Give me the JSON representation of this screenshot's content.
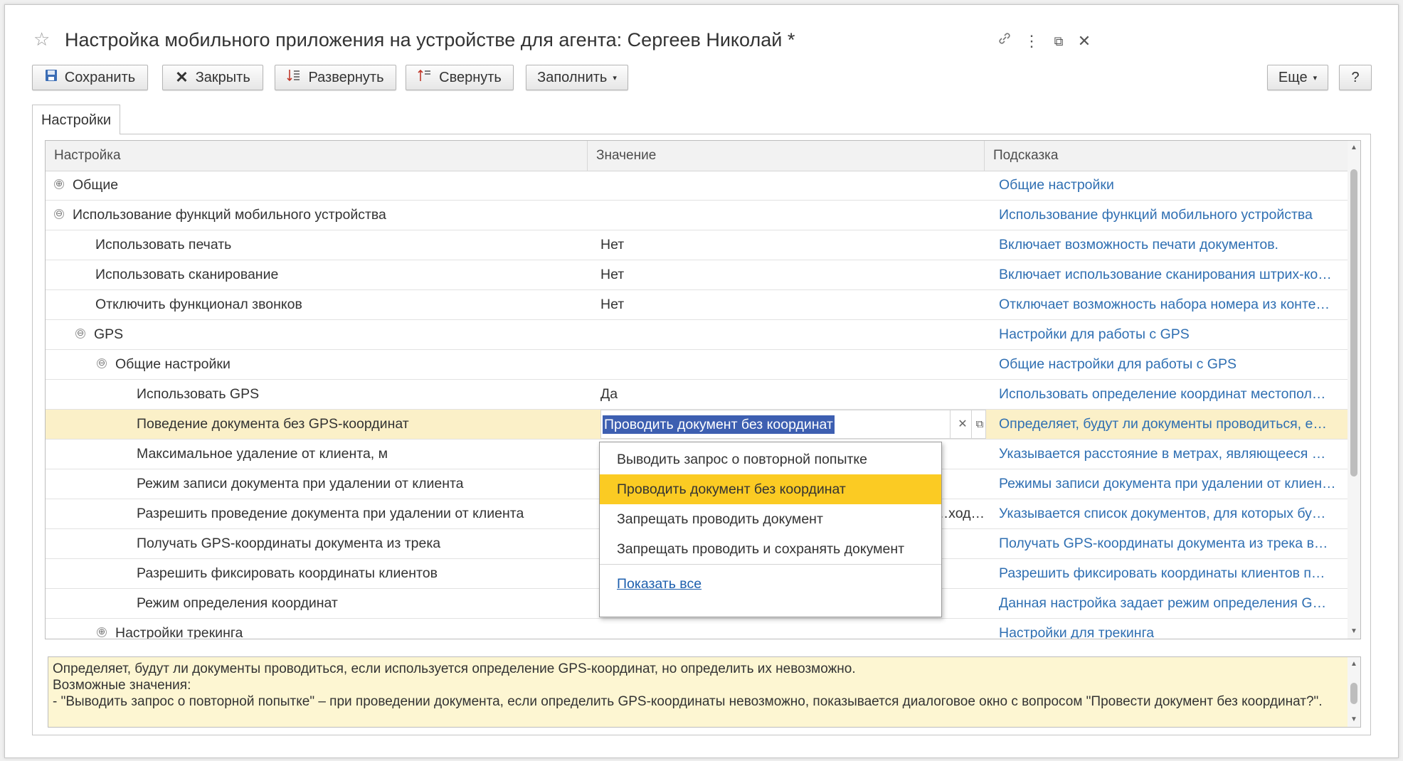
{
  "window": {
    "title": "Настройка мобильного приложения на устройстве для агента: Сергеев Николай *",
    "star_icon": "☆",
    "controls": {
      "link": "🔗",
      "more": "⋮",
      "restore": "⧉",
      "close": "✕"
    }
  },
  "toolbar": {
    "save_label": "Сохранить",
    "close_label": "Закрыть",
    "expand_label": "Развернуть",
    "collapse_label": "Свернуть",
    "fill_label": "Заполнить",
    "more_label": "Еще",
    "help_label": "?"
  },
  "tabs": [
    {
      "label": "Настройки"
    }
  ],
  "grid": {
    "headers": {
      "setting": "Настройка",
      "value": "Значение",
      "hint": "Подсказка"
    },
    "rows": [
      {
        "name": "Общие",
        "value": "",
        "hint": "Общие настройки",
        "tree": "⊕"
      },
      {
        "name": "Использование функций мобильного устройства",
        "value": "",
        "hint": "Использование функций мобильного устройства",
        "tree": "⊖"
      },
      {
        "name": "Использовать печать",
        "value": "Нет",
        "hint": "Включает возможность печати документов.",
        "tree": ""
      },
      {
        "name": "Использовать сканирование",
        "value": "Нет",
        "hint": "Включает использование сканирования штрих-ко…",
        "tree": ""
      },
      {
        "name": "Отключить функционал звонков",
        "value": "Нет",
        "hint": "Отключает возможность набора номера из конте…",
        "tree": ""
      },
      {
        "name": "GPS",
        "value": "",
        "hint": "Настройки для работы с GPS",
        "tree": "⊖"
      },
      {
        "name": "Общие настройки",
        "value": "",
        "hint": "Общие настройки для работы с GPS",
        "tree": "⊖"
      },
      {
        "name": "Использовать GPS",
        "value": "Да",
        "hint": "Использовать определение координат местопол…",
        "tree": ""
      },
      {
        "name": "Поведение документа без GPS-координат",
        "value": "Проводить документ без координат",
        "hint": "Определяет, будут ли документы проводиться, е…",
        "tree": ""
      },
      {
        "name": "Максимальное удаление от клиента, м",
        "value": "",
        "hint": "Указывается расстояние в метрах, являющееся …",
        "tree": ""
      },
      {
        "name": "Режим записи документа при удалении от клиента",
        "value": "",
        "hint": "Режимы записи документа при удалении от клиен…",
        "tree": ""
      },
      {
        "name": "Разрешить проведение документа при удалении от клиента",
        "value": "…ход…",
        "hint": "Указывается список документов, для которых бу…",
        "tree": ""
      },
      {
        "name": "Получать GPS-координаты документа из трека",
        "value": "",
        "hint": "Получать GPS-координаты документа из трека в…",
        "tree": ""
      },
      {
        "name": "Разрешить фиксировать координаты клиентов",
        "value": "",
        "hint": "Разрешить фиксировать координаты клиентов п…",
        "tree": ""
      },
      {
        "name": "Режим определения координат",
        "value": "",
        "hint": "Данная настройка задает режим определения G…",
        "tree": ""
      },
      {
        "name": "Настройки трекинга",
        "value": "",
        "hint": "Настройки для трекинга",
        "tree": "⊕"
      }
    ]
  },
  "dropdown": {
    "options": [
      "Выводить запрос о повторной попытке",
      "Проводить документ без координат",
      "Запрещать проводить документ",
      "Запрещать проводить и сохранять документ"
    ],
    "selected_index": 1,
    "show_all_label": "Показать все"
  },
  "hint_text": "Определяет, будут ли документы проводиться, если используется определение GPS-координат, но определить их невозможно.\nВозможные значения:\n- \"Выводить запрос о повторной попытке\" – при проведении документа, если определить GPS-координаты невозможно, показывается диалоговое окно с вопросом \"Провести документ без координат?\".",
  "colors": {
    "selected_row": "#fbf0c8",
    "active_option": "#fbcb23",
    "link": "#2f6fb2",
    "hint_bg": "#fdf6d2"
  }
}
